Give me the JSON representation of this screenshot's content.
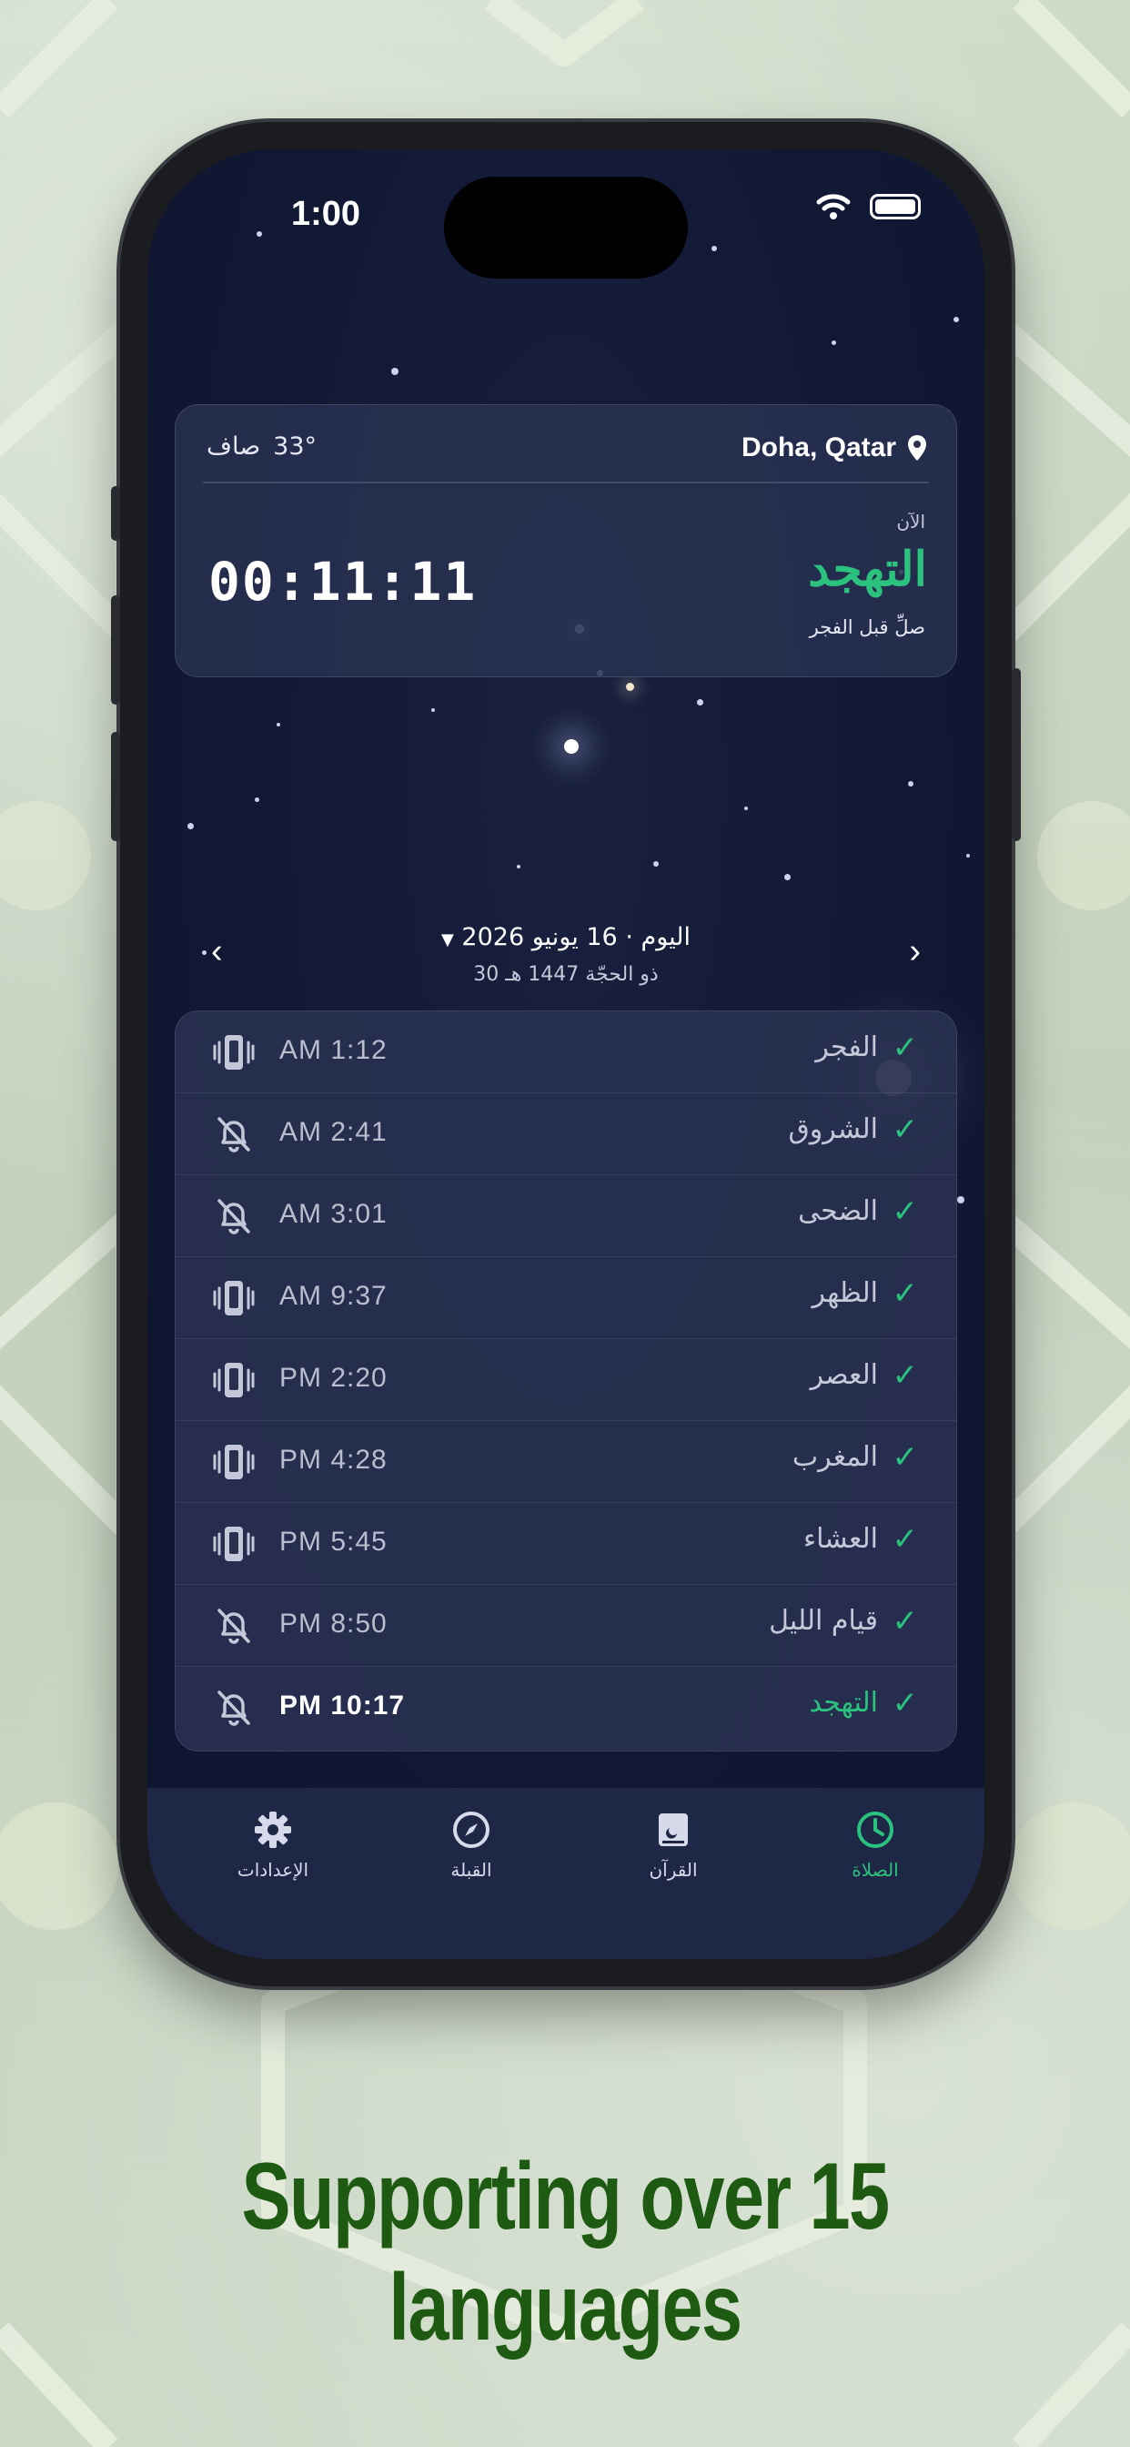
{
  "status": {
    "time": "1:00"
  },
  "location_card": {
    "location": "Doha, Qatar",
    "temperature": "33°",
    "weather": "صاف",
    "now_label": "الآن",
    "current_prayer": "التهجد",
    "current_subtitle": "صلِّ قبل الفجر",
    "countdown": "00:11:11"
  },
  "date_nav": {
    "gregorian": "اليوم · 16 يونيو 2026",
    "hijri": "30 ذو الحجّة 1447 هـ"
  },
  "prayers": [
    {
      "name": "الفجر",
      "time": "AM 1:12",
      "alert_icon": "phone-vibrate-icon",
      "checked": true
    },
    {
      "name": "الشروق",
      "time": "AM 2:41",
      "alert_icon": "bell-off-icon",
      "checked": true
    },
    {
      "name": "الضحى",
      "time": "AM 3:01",
      "alert_icon": "bell-off-icon",
      "checked": true
    },
    {
      "name": "الظهر",
      "time": "AM 9:37",
      "alert_icon": "phone-vibrate-icon",
      "checked": true
    },
    {
      "name": "العصر",
      "time": "PM 2:20",
      "alert_icon": "phone-vibrate-icon",
      "checked": true
    },
    {
      "name": "المغرب",
      "time": "PM 4:28",
      "alert_icon": "phone-vibrate-icon",
      "checked": true
    },
    {
      "name": "العشاء",
      "time": "PM 5:45",
      "alert_icon": "phone-vibrate-icon",
      "checked": true
    },
    {
      "name": "قيام الليل",
      "time": "PM 8:50",
      "alert_icon": "bell-off-icon",
      "checked": true
    },
    {
      "name": "التهجد",
      "time": "PM 10:17",
      "alert_icon": "bell-off-icon",
      "checked": true,
      "active": true
    }
  ],
  "tabs": {
    "settings": "الإعدادات",
    "qibla": "القبلة",
    "quran": "القرآن",
    "prayer": "الصلاة"
  },
  "caption": {
    "line1": "Supporting over 15",
    "line2": "languages"
  },
  "colors": {
    "accent": "#2bc27e",
    "caption": "#1f5a12",
    "screen_bg": "#111834"
  }
}
